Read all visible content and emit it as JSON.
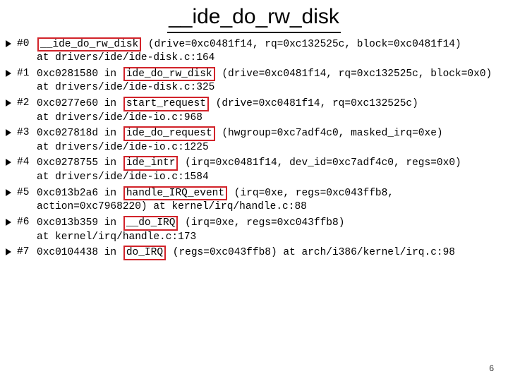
{
  "title": "__ide_do_rw_disk",
  "slide_number": "6",
  "frames": [
    {
      "num": "#0",
      "segments": [
        {
          "t": "box",
          "v": "__ide_do_rw_disk"
        },
        {
          "t": "plain",
          "v": " (drive=0xc0481f14, rq=0xc132525c, block=0xc0481f14)"
        }
      ],
      "cont": "at drivers/ide/ide-disk.c:164"
    },
    {
      "num": "#1",
      "segments": [
        {
          "t": "plain",
          "v": "0xc0281580 in "
        },
        {
          "t": "box",
          "v": "ide_do_rw_disk"
        },
        {
          "t": "plain",
          "v": " (drive=0xc0481f14, rq=0xc132525c, block=0x0)"
        }
      ],
      "cont": "at drivers/ide/ide-disk.c:325"
    },
    {
      "num": "#2",
      "segments": [
        {
          "t": "plain",
          "v": "0xc0277e60 in "
        },
        {
          "t": "box",
          "v": "start_request"
        },
        {
          "t": "plain",
          "v": " (drive=0xc0481f14, rq=0xc132525c)"
        }
      ],
      "cont": "at drivers/ide/ide-io.c:968"
    },
    {
      "num": "#3",
      "segments": [
        {
          "t": "plain",
          "v": "0xc027818d in "
        },
        {
          "t": "box",
          "v": "ide_do_request"
        },
        {
          "t": "plain",
          "v": " (hwgroup=0xc7adf4c0, masked_irq=0xe)"
        }
      ],
      "cont": "at drivers/ide/ide-io.c:1225"
    },
    {
      "num": "#4",
      "segments": [
        {
          "t": "plain",
          "v": "0xc0278755 in "
        },
        {
          "t": "box",
          "v": "ide_intr"
        },
        {
          "t": "plain",
          "v": " (irq=0xc0481f14, dev_id=0xc7adf4c0, regs=0x0)"
        }
      ],
      "cont": "at drivers/ide/ide-io.c:1584"
    },
    {
      "num": "#5",
      "segments": [
        {
          "t": "plain",
          "v": "0xc013b2a6 in "
        },
        {
          "t": "box",
          "v": "handle_IRQ_event"
        },
        {
          "t": "plain",
          "v": " (irq=0xe, regs=0xc043ffb8,"
        }
      ],
      "cont": "action=0xc7968220) at kernel/irq/handle.c:88"
    },
    {
      "num": "#6",
      "segments": [
        {
          "t": "plain",
          "v": "0xc013b359 in "
        },
        {
          "t": "box",
          "v": "__do_IRQ"
        },
        {
          "t": "plain",
          "v": " (irq=0xe, regs=0xc043ffb8)"
        }
      ],
      "cont": "at kernel/irq/handle.c:173"
    },
    {
      "num": "#7",
      "segments": [
        {
          "t": "plain",
          "v": "0xc0104438 in "
        },
        {
          "t": "box",
          "v": "do_IRQ"
        },
        {
          "t": "plain",
          "v": " (regs=0xc043ffb8) at arch/i386/kernel/irq.c:98"
        }
      ],
      "cont": null
    }
  ]
}
